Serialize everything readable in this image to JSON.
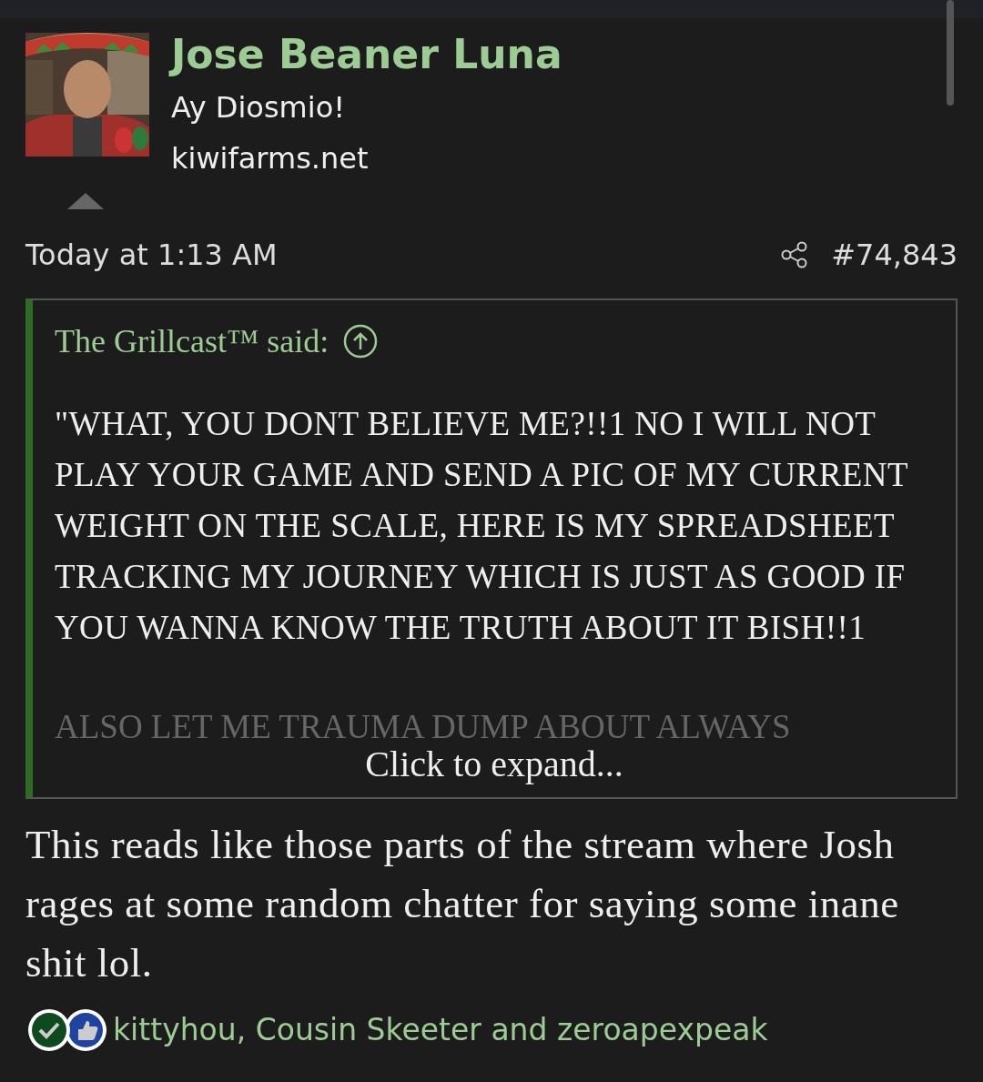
{
  "author": {
    "kind": "picture",
    "name": "Jose Beaner Luna",
    "title": "Ay Diosmio!",
    "site": "kiwifarms.net"
  },
  "post_meta": {
    "time": "Today at 1:13 AM",
    "number": "#74,843"
  },
  "quote": {
    "author": "The Grillcast™ said:",
    "text": "\"WHAT, YOU DONT BELIEVE ME?!!1 NO I WILL NOT PLAY YOUR GAME AND SEND A PIC OF MY CURRENT WEIGHT ON THE SCALE, HERE IS MY SPREADSHEET TRACKING MY JOURNEY WHICH IS JUST AS GOOD IF YOU WANNA KNOW THE TRUTH ABOUT IT BISH!!1",
    "faded_text": "ALSO LET ME TRAUMA DUMP ABOUT ALWAYS",
    "expand": "Click to expand..."
  },
  "body": "This reads like those parts of the stream where Josh rages at some random chatter for saying some inane shit lol.",
  "reactions": {
    "names": "kittyhou, Cousin Skeeter and zeroapexpeak"
  }
}
